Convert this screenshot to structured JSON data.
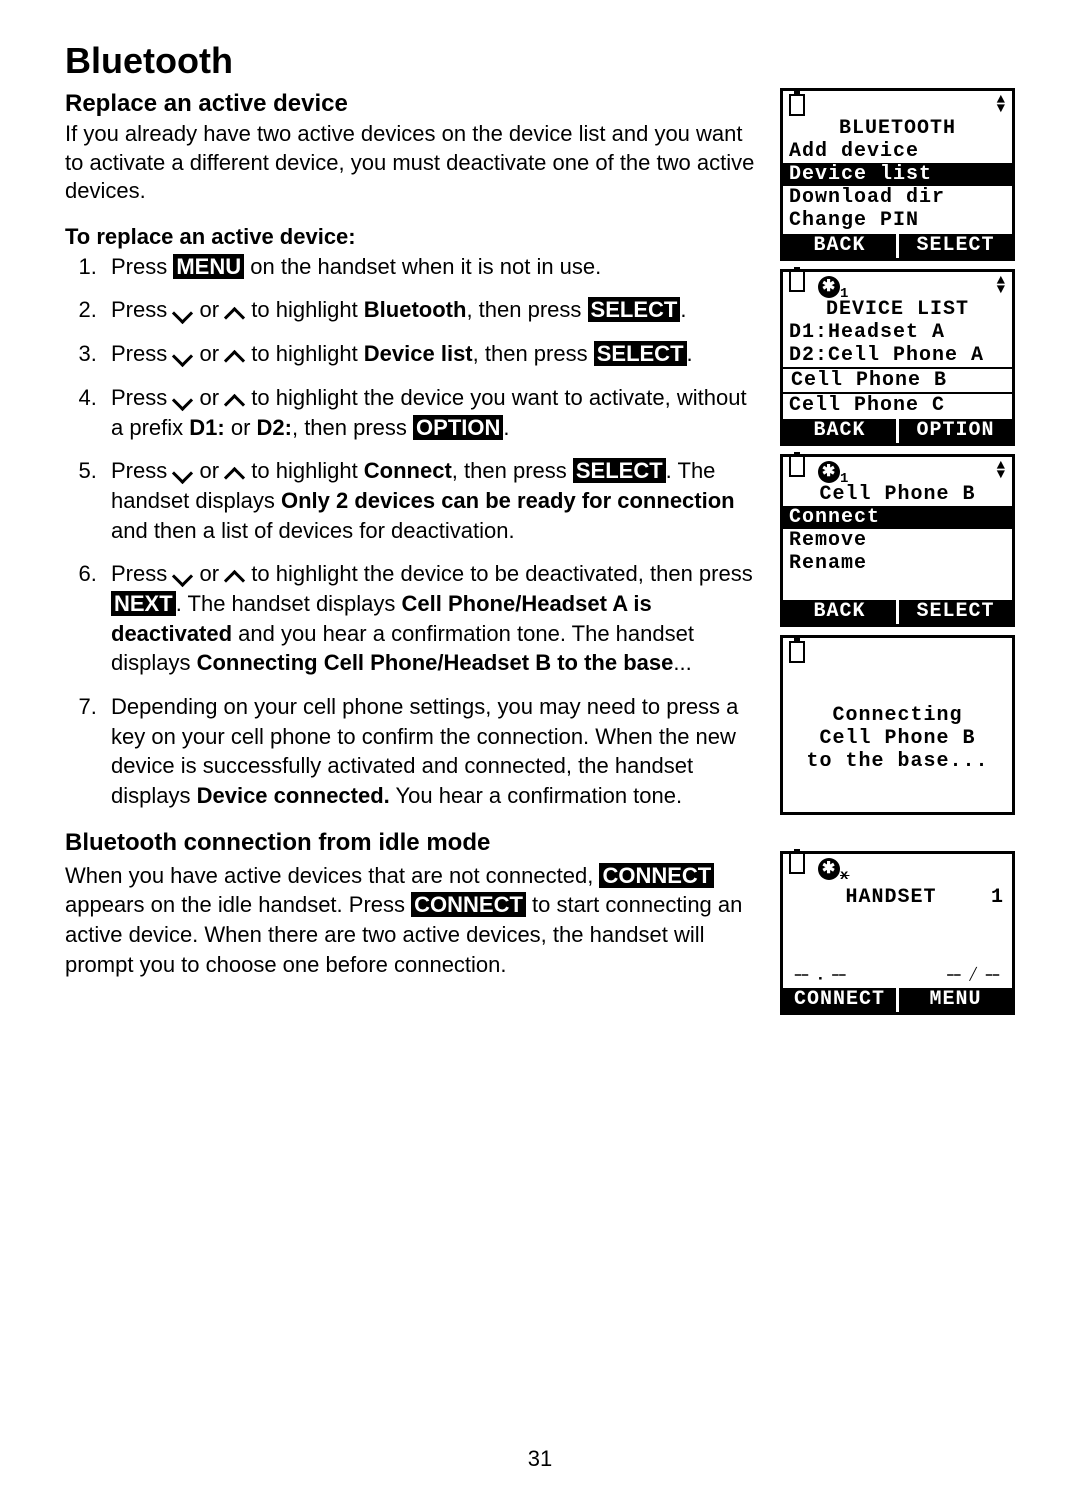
{
  "page_number": "31",
  "h1": "Bluetooth",
  "section1": {
    "title": "Replace an active device",
    "intro": "If you already have two active devices on the device list and you want to activate a different device, you must deactivate one of the two active devices.",
    "steps_heading": "To replace an active device:",
    "labels": {
      "menu": "MENU",
      "select": "SELECT",
      "option": "OPTION",
      "next": "NEXT",
      "connect": "CONNECT"
    },
    "step1_a": "Press ",
    "step1_b": " on the handset when it is not in use.",
    "step2_a": "Press ",
    "step2_or": " or ",
    "step2_b": " to highlight ",
    "step2_bold": "Bluetooth",
    "step2_c": ", then press ",
    "step3_b": " to highlight ",
    "step3_bold": "Device list",
    "step3_c": ", then press ",
    "step4_b": " to highlight the device you want to activate, without a prefix ",
    "step4_bold1": "D1:",
    "step4_or2": " or ",
    "step4_bold2": "D2:",
    "step4_c": ", then press ",
    "step5_b": " to highlight ",
    "step5_bold1": "Connect",
    "step5_c": ", then press ",
    "step5_d": ". The handset displays ",
    "step5_bold2": "Only 2 devices can be ready for connection",
    "step5_e": " and then a list of devices for deactivation.",
    "step6_b": " to highlight the device to be deactivated, then press ",
    "step6_c": ". The handset displays ",
    "step6_bold1": "Cell Phone/Headset A is deactivated",
    "step6_d": " and you hear a confirmation tone. The handset displays ",
    "step6_bold2": "Connecting Cell Phone/Headset B to the base",
    "step6_e": "...",
    "step7": "Depending on your cell phone settings, you may need to press a key on your cell phone to confirm the connection. When the new device is successfully activated and connected, the handset displays ",
    "step7_bold": "Device connected.",
    "step7_b": " You hear a confirmation tone."
  },
  "section2": {
    "title": "Bluetooth connection from idle mode",
    "p_a": "When you have active devices that are not connected, ",
    "p_b": " appears on the idle handset. Press ",
    "p_c": " to start connecting an active device. When there are two active devices, the handset will prompt you to choose one before connection."
  },
  "lcd1": {
    "title": "BLUETOOTH",
    "items": [
      "Add device",
      "Device list",
      "Download dir",
      "Change PIN"
    ],
    "soft_l": "BACK",
    "soft_r": "SELECT"
  },
  "lcd2": {
    "sub": "1",
    "title": "DEVICE LIST",
    "items": [
      "D1:Headset A",
      "D2:Cell Phone A",
      "Cell Phone B",
      "Cell Phone C"
    ],
    "soft_l": "BACK",
    "soft_r": "OPTION"
  },
  "lcd3": {
    "sub": "1",
    "title": "Cell Phone B",
    "items": [
      "Connect",
      "Remove",
      "Rename"
    ],
    "soft_l": "BACK",
    "soft_r": "SELECT"
  },
  "lcd4": {
    "lines": [
      "Connecting",
      "Cell Phone B",
      "to the base..."
    ]
  },
  "lcd5": {
    "su_strike": "x",
    "title": "HANDSET",
    "num": "1",
    "dash": "⎯⎯ ⎯⎯ ⎯⎯",
    "soft_l": "CONNECT",
    "soft_r": "MENU"
  }
}
